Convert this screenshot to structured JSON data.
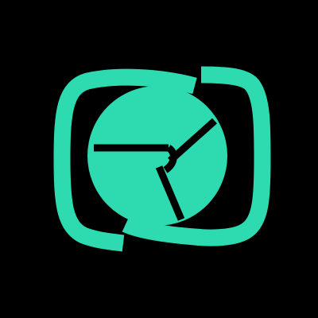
{
  "app": {
    "icon": "camera-aperture-logo-icon"
  },
  "colors": {
    "background": "#000000",
    "accent": "#2EDBB0",
    "cutout": "#000000"
  }
}
